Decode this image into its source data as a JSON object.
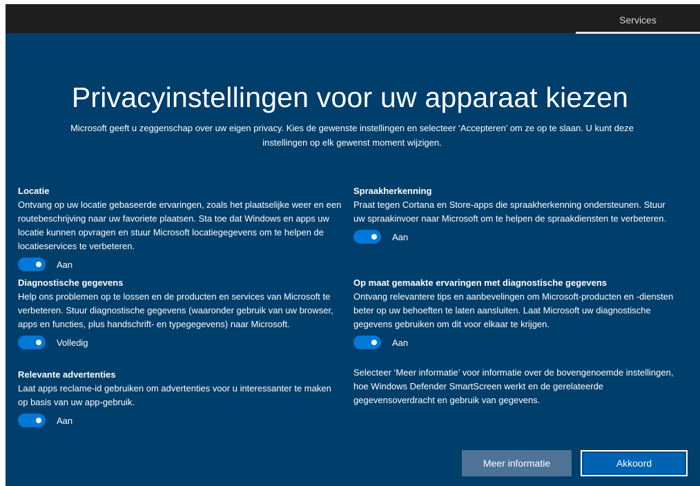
{
  "header": {
    "tab_label": "Services"
  },
  "page": {
    "title": "Privacyinstellingen voor uw apparaat kiezen",
    "subtitle": "Microsoft geeft u zeggenschap over uw eigen privacy. Kies de gewenste instellingen en selecteer ‘Accepteren’ om ze op te slaan. U kunt deze instellingen op elk gewenst moment wijzigen."
  },
  "settings": {
    "location": {
      "title": "Locatie",
      "description": "Ontvang op uw locatie gebaseerde ervaringen, zoals het plaatselijke weer en een routebeschrijving naar uw favoriete plaatsen. Sta toe dat Windows en apps uw locatie kunnen opvragen en stuur Microsoft locatiegegevens om te helpen de locatieservices te verbeteren.",
      "state": "Aan"
    },
    "diagnostics": {
      "title": "Diagnostische gegevens",
      "description": "Help ons problemen op te lossen en de producten en services van Microsoft te verbeteren. Stuur diagnostische gegevens (waaronder gebruik van uw browser, apps en functies, plus handschrift- en typegegevens) naar Microsoft.",
      "state": "Volledig"
    },
    "ads": {
      "title": "Relevante advertenties",
      "description": "Laat apps reclame-id gebruiken om advertenties voor u interessanter te maken op basis van uw app-gebruik.",
      "state": "Aan"
    },
    "speech": {
      "title": "Spraakherkenning",
      "description": "Praat tegen Cortana en Store-apps die spraakherkenning ondersteunen. Stuur uw spraakinvoer naar Microsoft om te helpen de spraakdiensten te verbeteren.",
      "state": "Aan"
    },
    "tailored": {
      "title": "Op maat gemaakte ervaringen met diagnostische gegevens",
      "description": "Ontvang relevantere tips en aanbevelingen om Microsoft-producten en -diensten beter op uw behoeften te laten aansluiten. Laat Microsoft uw diagnostische gegevens gebruiken om dit voor elkaar te krijgen.",
      "state": "Aan"
    }
  },
  "info_text": "Selecteer ‘Meer informatie’ voor informatie over de bovengenoemde instellingen, hoe Windows Defender SmartScreen werkt en de gerelateerde gegevensoverdracht en gebruik van gegevens.",
  "buttons": {
    "more_info": "Meer informatie",
    "accept": "Akkoord"
  },
  "colors": {
    "background": "#003e6b",
    "toggle_on": "#0078d7",
    "accept_button": "#0063b1",
    "secondary_button": "#4f7397"
  }
}
